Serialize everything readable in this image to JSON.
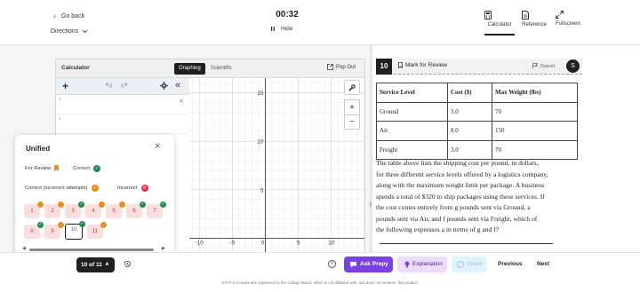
{
  "header": {
    "go_back": "Go back",
    "directions": "Directions",
    "timer": "00:32",
    "hide": "Hide",
    "tools": [
      {
        "label": "Calculator",
        "icon": "calculator-icon",
        "active": true
      },
      {
        "label": "Reference",
        "icon": "reference-icon",
        "active": false
      },
      {
        "label": "Fullscreen",
        "icon": "fullscreen-icon",
        "active": false
      }
    ]
  },
  "calculator": {
    "title": "Calculator",
    "tabs": [
      "Graphing",
      "Scientific"
    ],
    "active_tab": "Graphing",
    "pop_out": "Pop Out",
    "expression_rows": [
      "1",
      "2"
    ],
    "graph": {
      "x_ticks": [
        "-10",
        "-5",
        "0",
        "5",
        "10"
      ],
      "y_ticks": [
        "15",
        "10",
        "5"
      ]
    }
  },
  "question": {
    "number": "10",
    "mark_for_review": "Mark for Review",
    "report": "Report",
    "table": {
      "headers": [
        "Service Level",
        "Cost ($)",
        "Max Weight (lbs)"
      ],
      "rows": [
        [
          "Ground",
          "3.0",
          "70"
        ],
        [
          "Air",
          "8.0",
          "150"
        ],
        [
          "Freight",
          "3.0",
          "70"
        ]
      ]
    },
    "text_lines": [
      "The table above lists the shipping cost per pound, in dollars,",
      "for three different service levels offered by a logistics company,",
      "along with the maximum weight limit per package. A business",
      "spends a total of $320 to ship packages using these services. If",
      "the cost comes entirely from g pounds sent via Ground, a",
      "pounds sent via Air, and f pounds sent via Freight, which of",
      "the following expresses a in terms of g and f?"
    ]
  },
  "unified": {
    "title": "Unified",
    "legend": {
      "for_review": "For Review",
      "correct": "Correct",
      "correct_incorrect": "Correct (incorrect attempts)",
      "incorrect": "Incorrect"
    },
    "questions": [
      "1",
      "2",
      "3",
      "4",
      "5",
      "6",
      "7",
      "8",
      "9",
      "10",
      "11"
    ],
    "current": "10"
  },
  "footer": {
    "progress": "10 of 11",
    "ask_prepy": "Ask Prepy",
    "explanation": "Explanation",
    "check": "Check",
    "previous": "Previous",
    "next": "Next",
    "trademark": "SAT® is a trademark registered by the College Board, which is not affiliated with, and does not endorse, this product."
  },
  "colors": {
    "ask_prepy_bg": "#7b3fe4",
    "explanation_bg": "#ecdcff",
    "check_bg": "#e0f3ff",
    "correct_green": "#1f8a4c",
    "attempt_orange": "#e9901c",
    "incorrect_red": "#e3334a",
    "question_pink": "#fbdede"
  }
}
